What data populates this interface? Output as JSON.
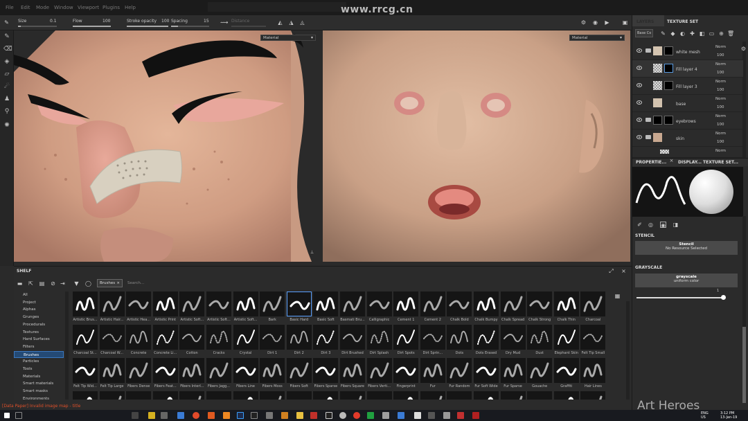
{
  "watermark": "www.rrcg.cn",
  "menu": [
    "File",
    "Edit",
    "Mode",
    "Window",
    "Viewport",
    "Plugins",
    "Help"
  ],
  "toolbar": {
    "size_label": "Size",
    "size_value": "0.1",
    "flow_label": "Flow",
    "flow_value": "100",
    "stroke_label": "Stroke opacity",
    "stroke_value": "100",
    "spacing_label": "Spacing",
    "spacing_value": "15",
    "distance_label": "Distance"
  },
  "viewports": {
    "left_mode": "Material",
    "right_mode": "Material"
  },
  "right_panel": {
    "tabs": [
      "LAYERS",
      "TEXTURE SET"
    ],
    "channel_select": "Base Co",
    "layers": [
      {
        "name": "white mesh",
        "blend": "Norm",
        "opacity": "100"
      },
      {
        "name": "Fill layer 4",
        "blend": "Norm",
        "opacity": "100"
      },
      {
        "name": "Fill layer 3",
        "blend": "Norm",
        "opacity": "100"
      },
      {
        "name": "base",
        "blend": "Norm",
        "opacity": "100"
      },
      {
        "name": "eyebrows",
        "blend": "Norm",
        "opacity": "100"
      },
      {
        "name": "skin",
        "blend": "Norm",
        "opacity": "100"
      },
      {
        "name": "",
        "blend": "Norm",
        "opacity": ""
      }
    ],
    "prop_tabs": [
      "PROPERTIE...",
      "DISPLAY...",
      "TEXTURE SET..."
    ],
    "stencil": {
      "title": "STENCIL",
      "label": "Stencil",
      "value": "No Resource Selected"
    },
    "grayscale": {
      "title": "GRAYSCALE",
      "label": "grayscale",
      "value": "uniform color",
      "slider_value": "1"
    }
  },
  "shelf": {
    "title": "SHELF",
    "filter_tag": "Brushes",
    "search_placeholder": "Search...",
    "categories": [
      "All",
      "Project",
      "Alphas",
      "Grunges",
      "Procedurals",
      "Textures",
      "Hard Surfaces",
      "Filters",
      "Brushes",
      "Particles",
      "Tools",
      "Materials",
      "Smart materials",
      "Smart masks",
      "Environments"
    ],
    "selected_category": "Brushes",
    "brushes": [
      [
        "Artistic Brus...",
        "Artistic Hair...",
        "Artistic Hea...",
        "Artistic Print",
        "Artistic Soft...",
        "Artistic Soft...",
        "Artistic Soft...",
        "Bark",
        "Basic Hard",
        "Basic Soft",
        "Basmati Bru...",
        "Calligraphic",
        "Cement 1",
        "Cement 2",
        "Chalk Bold",
        "Chalk Bumpy",
        "Chalk Spread",
        "Chalk Strong",
        "Chalk Thin",
        "Charcoal"
      ],
      [
        "Charcoal St...",
        "Charcoal W...",
        "Concrete",
        "Concrete Li...",
        "Cotton",
        "Cracks",
        "Crystal",
        "Dirt 1",
        "Dirt 2",
        "Dirt 3",
        "Dirt Brushed",
        "Dirt Splash",
        "Dirt Spots",
        "Dirt Sprin...",
        "Dots",
        "Dots Erased",
        "Dry Mud",
        "Dust",
        "Elephant Skin",
        "Felt Tip Small"
      ],
      [
        "Felt Tip Wid...",
        "Felt Tip Large",
        "Fibers Dense",
        "Fibers Feat...",
        "Fibers Interl...",
        "Fibers Jagg...",
        "Fibers Line",
        "Fibers Moss",
        "Fibers Soft",
        "Fibers Sparse",
        "Fibers Square",
        "Fibers Verti...",
        "Fingerprint",
        "Fur",
        "Fur Random",
        "Fur Soft Wide",
        "Fur Sparse",
        "Gouache",
        "Graffiti",
        "Hair Lines"
      ],
      [
        "",
        "",
        "",
        "",
        "",
        "",
        "",
        "",
        "",
        "",
        "",
        "",
        "",
        "",
        "",
        "",
        "",
        "",
        "",
        ""
      ]
    ],
    "selected_brush": "Basic Hard"
  },
  "status": "[Data Paper] Invalid image map - title",
  "watermark_bottom": "Art Heroes",
  "taskbar": {
    "lang": "ENG",
    "region": "US",
    "time": "3:12 PM",
    "date": "13-Jan-19"
  }
}
